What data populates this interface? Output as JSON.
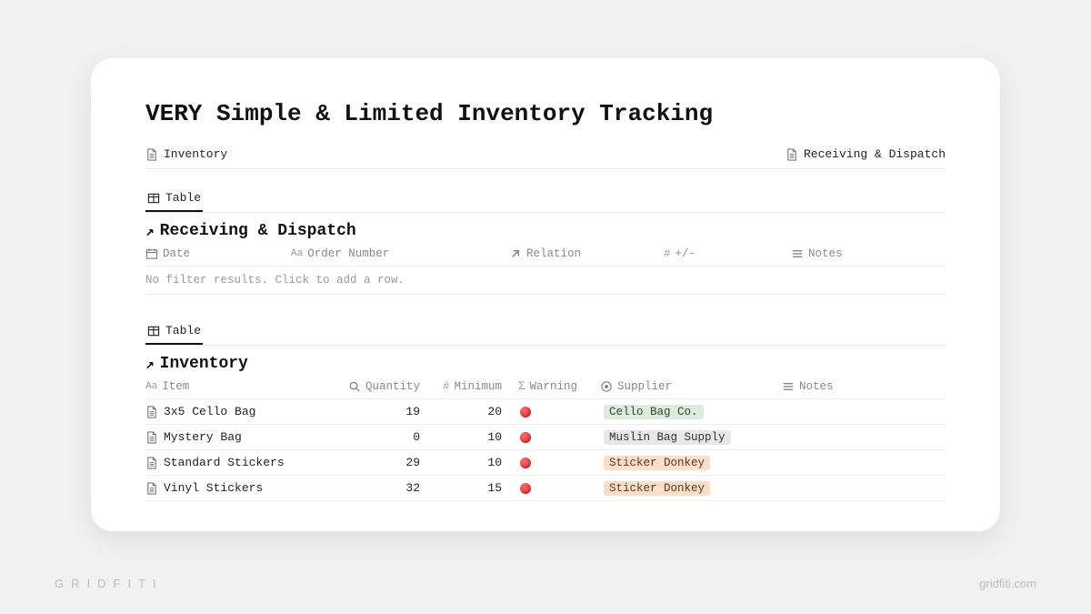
{
  "pageTitle": "VERY Simple & Limited Inventory Tracking",
  "topLinks": {
    "left": "Inventory",
    "right": "Receiving & Dispatch"
  },
  "tabLabel": "Table",
  "receivingDispatch": {
    "title": "Receiving & Dispatch",
    "columns": {
      "date": "Date",
      "orderNumber": "Order Number",
      "relation": "Relation",
      "plusMinus": "+/-",
      "notes": "Notes"
    },
    "emptyMessage": "No filter results. Click to add a row."
  },
  "inventory": {
    "title": "Inventory",
    "columns": {
      "item": "Item",
      "quantity": "Quantity",
      "minimum": "Minimum",
      "warning": "Warning",
      "supplier": "Supplier",
      "notes": "Notes"
    },
    "rows": [
      {
        "item": "3x5 Cello Bag",
        "quantity": "19",
        "minimum": "20",
        "warning": true,
        "supplier": "Cello Bag Co.",
        "supplierColor": "green"
      },
      {
        "item": "Mystery Bag",
        "quantity": "0",
        "minimum": "10",
        "warning": true,
        "supplier": "Muslin Bag Supply",
        "supplierColor": "gray"
      },
      {
        "item": "Standard Stickers",
        "quantity": "29",
        "minimum": "10",
        "warning": true,
        "supplier": "Sticker Donkey",
        "supplierColor": "orange"
      },
      {
        "item": "Vinyl Stickers",
        "quantity": "32",
        "minimum": "15",
        "warning": true,
        "supplier": "Sticker Donkey",
        "supplierColor": "orange"
      }
    ]
  },
  "branding": {
    "left": "GRIDFITI",
    "right": "gridfiti.com"
  },
  "icons": {
    "prefixHash": "#",
    "prefixAa": "Aa",
    "prefixSigma": "Σ"
  }
}
